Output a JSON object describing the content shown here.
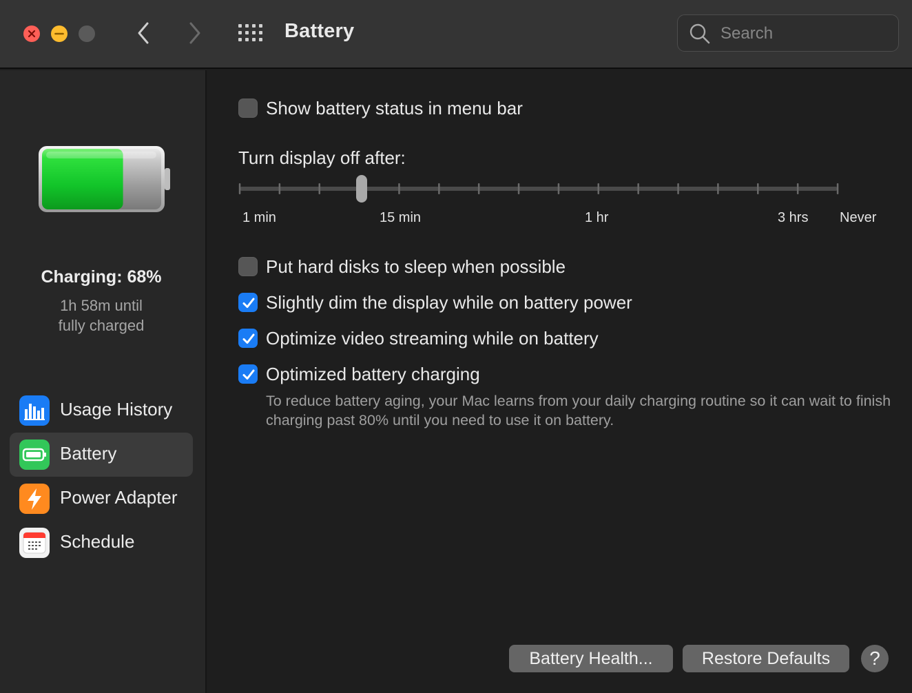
{
  "window": {
    "title": "Battery"
  },
  "search": {
    "placeholder": "Search"
  },
  "sidebar": {
    "status_title": "Charging: 68%",
    "status_line1": "1h 58m until",
    "status_line2": "fully charged",
    "charge_level": 0.68,
    "items": [
      {
        "label": "Usage History",
        "icon": "bar-chart-icon",
        "color": "#1a7cf5",
        "selected": false
      },
      {
        "label": "Battery",
        "icon": "battery-icon",
        "color": "#32c759",
        "selected": true
      },
      {
        "label": "Power Adapter",
        "icon": "lightning-bolt-icon",
        "color": "#ff8a1f",
        "selected": false
      },
      {
        "label": "Schedule",
        "icon": "calendar-icon",
        "color": "#f2f2f2",
        "selected": false
      }
    ]
  },
  "options": {
    "menu_bar": {
      "label": "Show battery status in menu bar",
      "checked": false
    },
    "disk_sleep": {
      "label": "Put hard disks to sleep when possible",
      "checked": false
    },
    "dim_display": {
      "label": "Slightly dim the display while on battery power",
      "checked": true
    },
    "video_streaming": {
      "label": "Optimize video streaming while on battery",
      "checked": true
    },
    "optimized_charging": {
      "label": "Optimized battery charging",
      "checked": true,
      "description": "To reduce battery aging, your Mac learns from your daily charging routine so it can wait to finish charging past 80% until you need to use it on battery."
    }
  },
  "display_slider": {
    "label": "Turn display off after:",
    "tick_labels": [
      "1 min",
      "15 min",
      "1 hr",
      "3 hrs",
      "Never"
    ],
    "tick_count": 16,
    "value": "10 min"
  },
  "buttons": {
    "battery_health": "Battery Health...",
    "restore_defaults": "Restore Defaults",
    "help": "?"
  },
  "colors": {
    "accent": "#1a7cf5",
    "close": "#ff5f57",
    "minimize": "#febc2e",
    "battery_fill": "#2bd13d"
  }
}
